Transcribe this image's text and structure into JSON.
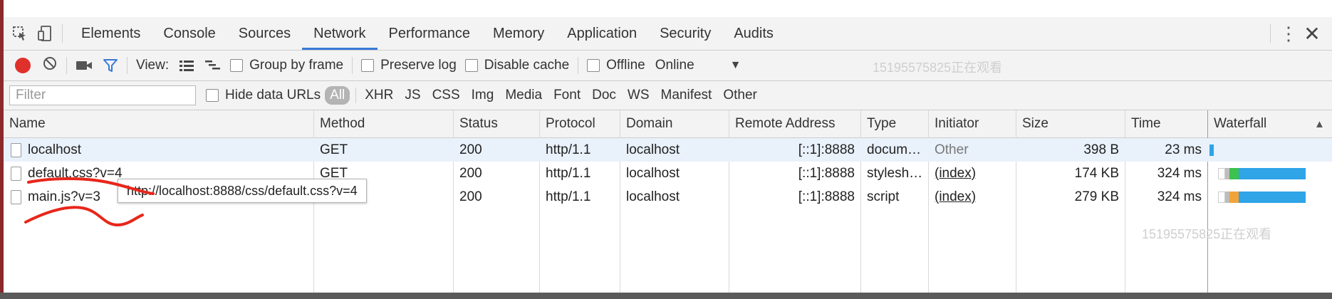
{
  "tabs": [
    "Elements",
    "Console",
    "Sources",
    "Network",
    "Performance",
    "Memory",
    "Application",
    "Security",
    "Audits"
  ],
  "active_tab": "Network",
  "toolbar": {
    "view_label": "View:",
    "group_by_frame": "Group by frame",
    "preserve_log": "Preserve log",
    "disable_cache": "Disable cache",
    "offline": "Offline",
    "throttle": "Online"
  },
  "watermark": "15195575825正在观看",
  "filter": {
    "placeholder": "Filter",
    "hide_data_urls": "Hide data URLs",
    "types": [
      "All",
      "XHR",
      "JS",
      "CSS",
      "Img",
      "Media",
      "Font",
      "Doc",
      "WS",
      "Manifest",
      "Other"
    ]
  },
  "columns": [
    "Name",
    "Method",
    "Status",
    "Protocol",
    "Domain",
    "Remote Address",
    "Type",
    "Initiator",
    "Size",
    "Time",
    "Waterfall"
  ],
  "sort_indicator": "▲",
  "rows": [
    {
      "name": "localhost",
      "method": "GET",
      "status": "200",
      "protocol": "http/1.1",
      "domain": "localhost",
      "remote": "[::1]:8888",
      "type": "docum…",
      "initiator": "Other",
      "size": "398 B",
      "time": "23 ms"
    },
    {
      "name": "default.css?v=4",
      "method": "GET",
      "status": "200",
      "protocol": "http/1.1",
      "domain": "localhost",
      "remote": "[::1]:8888",
      "type": "stylesh…",
      "initiator": "(index)",
      "size": "174 KB",
      "time": "324 ms"
    },
    {
      "name": "main.js?v=3",
      "method": "GET",
      "status": "200",
      "protocol": "http/1.1",
      "domain": "localhost",
      "remote": "[::1]:8888",
      "type": "script",
      "initiator": "(index)",
      "size": "279 KB",
      "time": "324 ms"
    }
  ],
  "tooltip": "http://localhost:8888/css/default.css?v=4",
  "colors": {
    "accent": "#3879d9",
    "record": "#e0302c",
    "waterfall_blue": "#2fa4e7",
    "waterfall_green": "#3cc24e",
    "waterfall_orange": "#f2a33a",
    "scribble": "#e8261a"
  }
}
